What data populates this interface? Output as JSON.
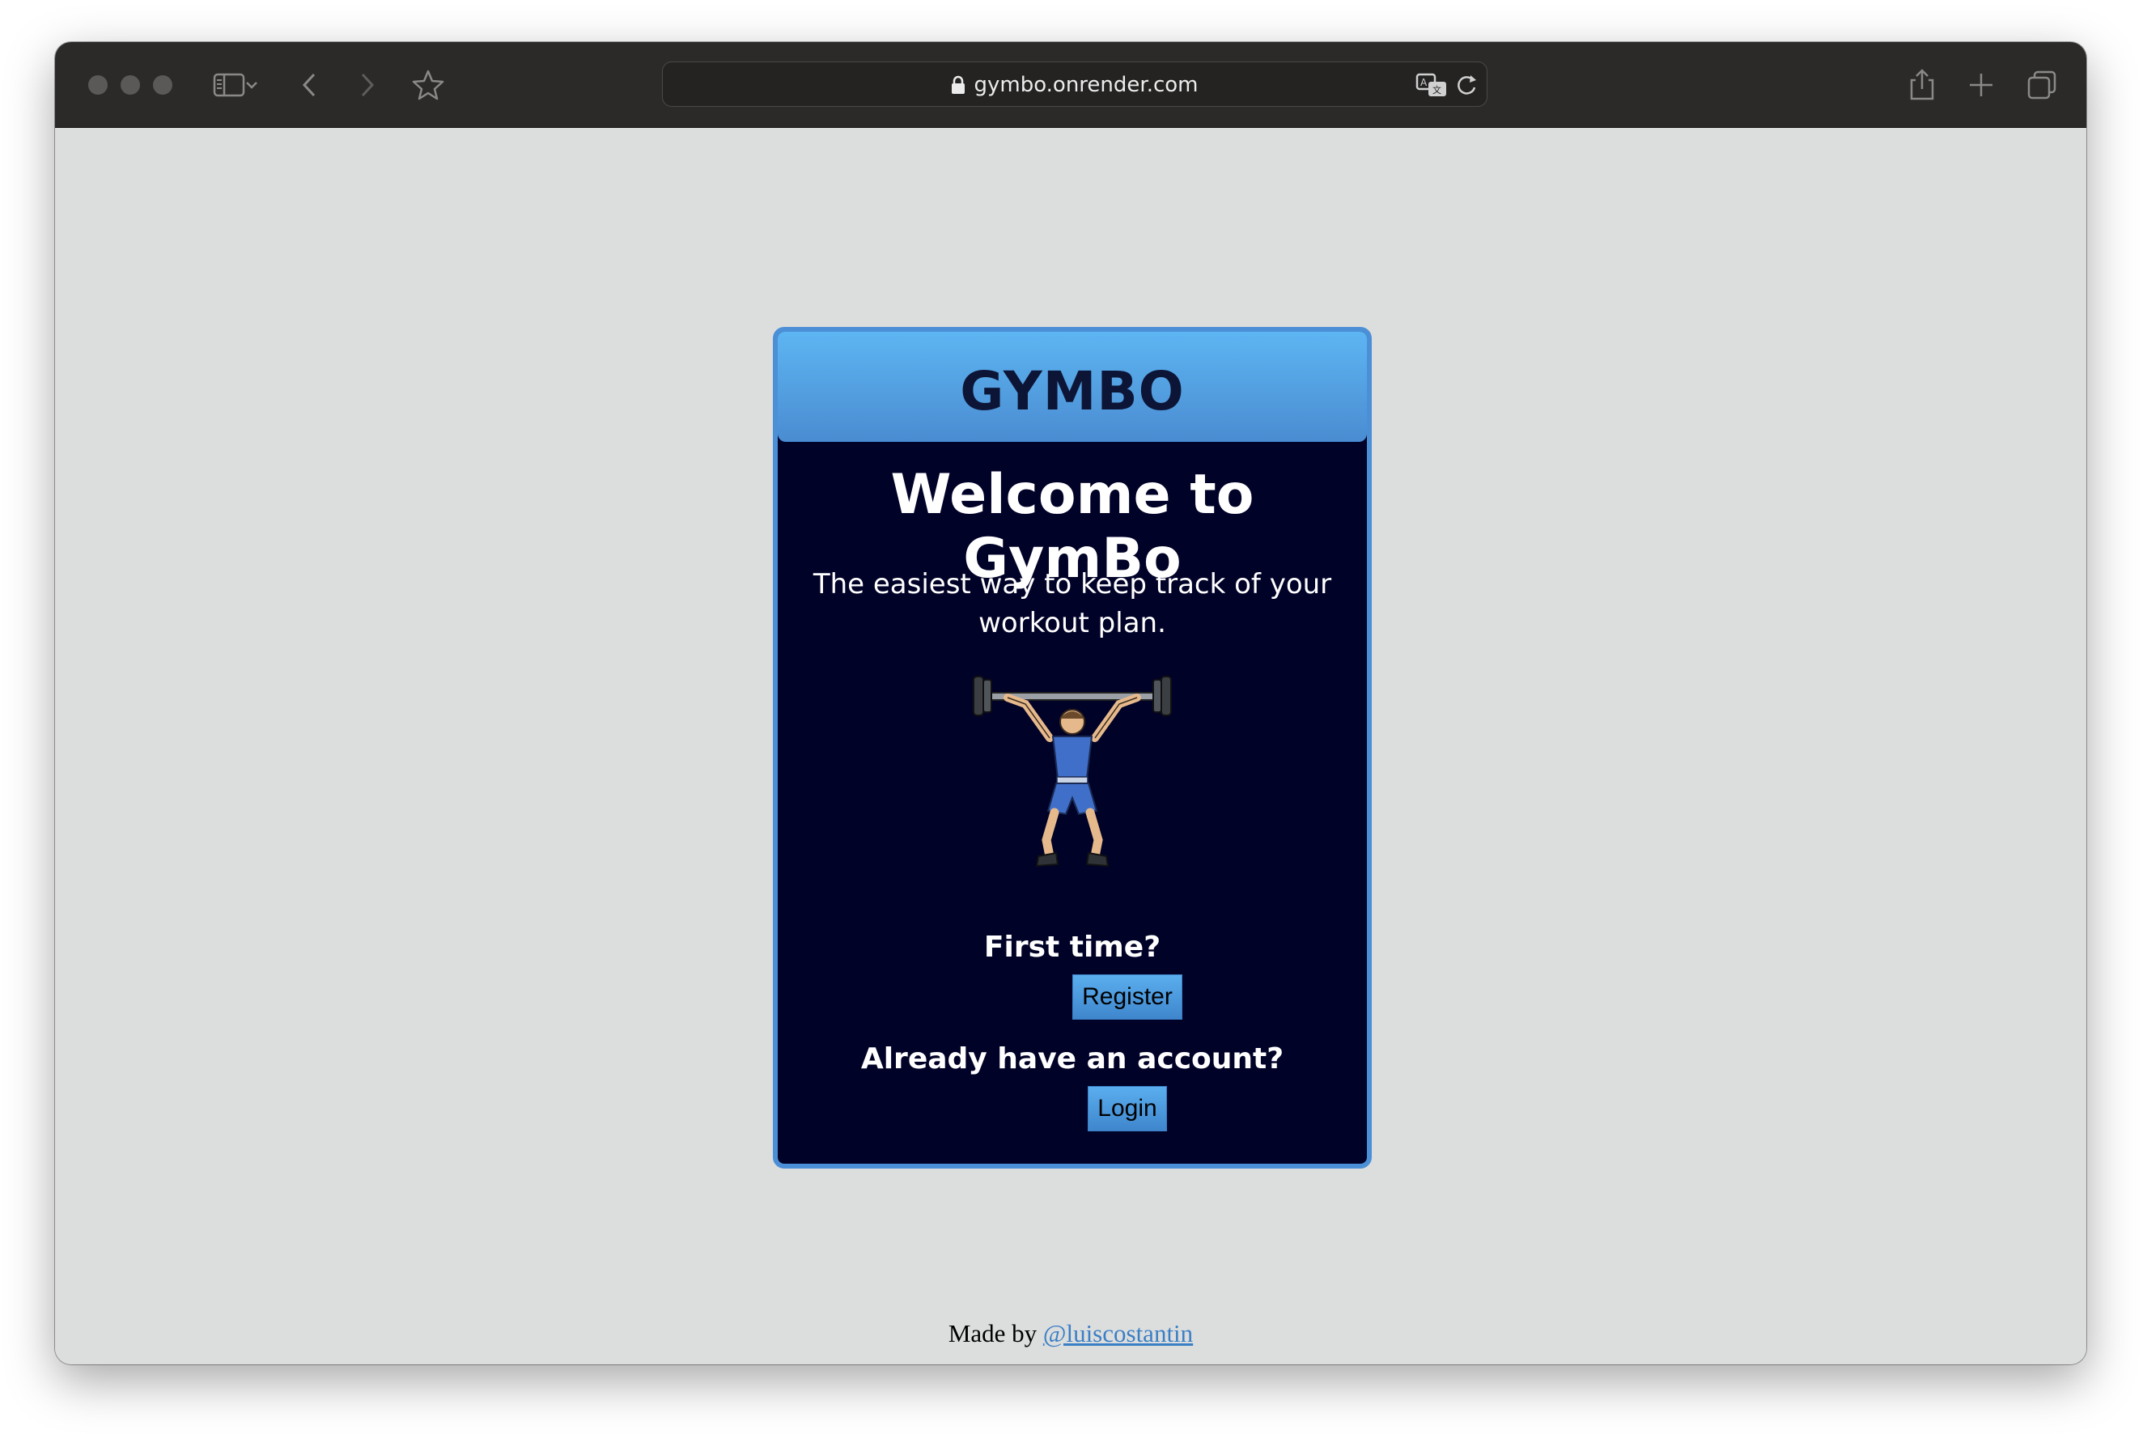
{
  "browser": {
    "url": "gymbo.onrender.com",
    "icons": {
      "close": "close-traffic-light",
      "minimize": "minimize-traffic-light",
      "zoom": "zoom-traffic-light",
      "sidebar": "sidebar-icon",
      "chevron": "chevron-down-icon",
      "back": "back-arrow-icon",
      "forward": "forward-arrow-icon",
      "bookmark": "star-icon",
      "lock": "lock-icon",
      "translate": "translate-icon",
      "reload": "reload-icon",
      "share": "share-icon",
      "new_tab": "plus-icon",
      "tabs": "tab-overview-icon"
    }
  },
  "card": {
    "brand": "GYMBO",
    "title": "Welcome to GymBo",
    "tagline": "The easiest way to keep track of your workout plan.",
    "image": "weightlifter-illustration",
    "first_time": "First time?",
    "register_label": "Register",
    "have_account": "Already have an account?",
    "login_label": "Login"
  },
  "footer": {
    "prefix": "Made by",
    "link_text": "@luiscostantin"
  },
  "colors": {
    "card_bg": "#010228",
    "card_border": "#4b8fd6",
    "header_top": "#5db5f2",
    "header_bottom": "#4a8cd1",
    "page_bg": "#dcdddd",
    "toolbar_bg": "#2b2a29",
    "link": "#3a7fc5"
  }
}
